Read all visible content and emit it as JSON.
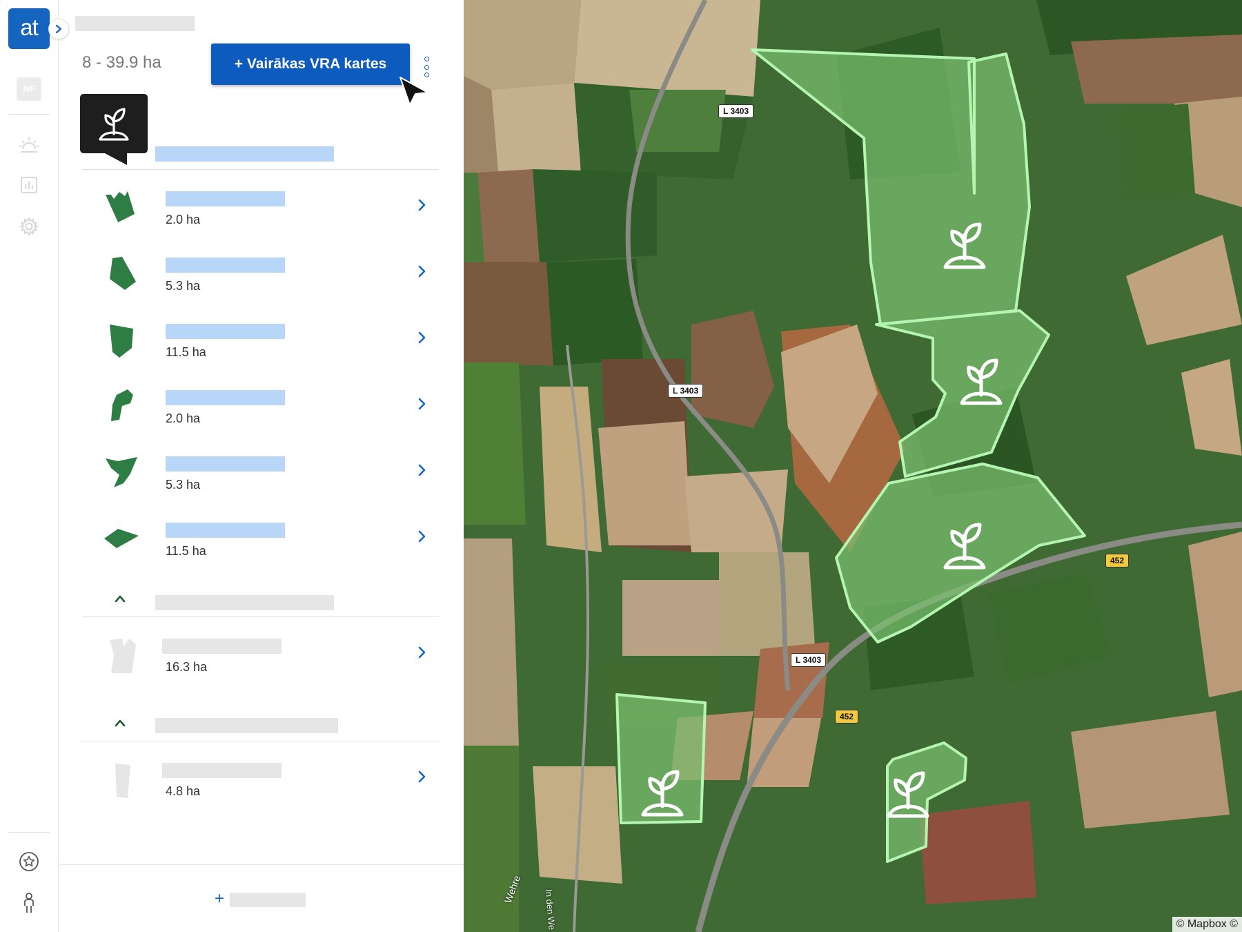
{
  "app": {
    "logo_text": "at",
    "brand_color": "#1565c0"
  },
  "rail": {
    "badge": "NF",
    "icons": [
      "weather-icon",
      "chart-icon",
      "gear-icon",
      "star-icon",
      "person-icon"
    ]
  },
  "panel": {
    "size_range": "8 - 39.9 ha",
    "vra_button_label": "+ Vairākas VRA kartes",
    "groups": [
      {
        "fields": [
          {
            "area": "2.0 ha"
          },
          {
            "area": "5.3 ha"
          },
          {
            "area": "11.5 ha"
          },
          {
            "area": "2.0 ha"
          },
          {
            "area": "5.3 ha"
          },
          {
            "area": "11.5 ha"
          }
        ]
      },
      {
        "fields": [
          {
            "area": "16.3 ha"
          }
        ]
      },
      {
        "fields": [
          {
            "area": "4.8 ha"
          }
        ]
      }
    ],
    "add_label": "+"
  },
  "map": {
    "road_labels": [
      "L 3403",
      "L 3403",
      "L 3403",
      "452",
      "452"
    ],
    "street_labels": [
      "Wehre",
      "In den We"
    ],
    "attribution": "© Mapbox ©",
    "field_highlight_color": "#9ef5a6"
  }
}
